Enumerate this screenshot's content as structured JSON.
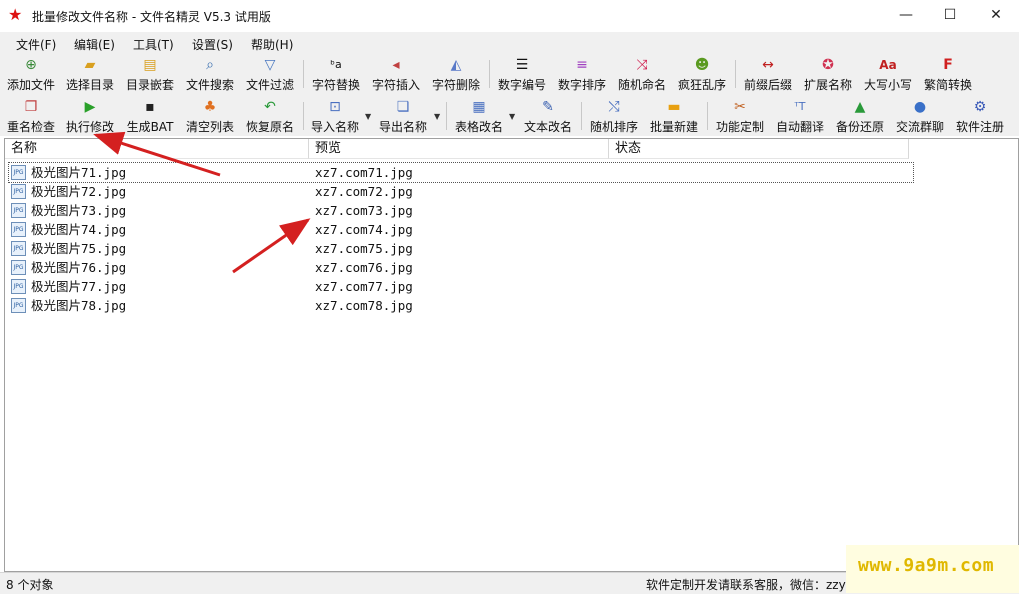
{
  "window": {
    "title": "批量修改文件名称 - 文件名精灵 V5.3 试用版",
    "controls": [
      "—",
      "☐",
      "✕"
    ]
  },
  "menu": [
    "文件(F)",
    "编辑(E)",
    "工具(T)",
    "设置(S)",
    "帮助(H)"
  ],
  "toolbar1": [
    {
      "label": "添加文件",
      "icon": "add-file-icon"
    },
    {
      "label": "选择目录",
      "icon": "folder-open-icon"
    },
    {
      "label": "目录嵌套",
      "icon": "folder-nest-icon"
    },
    {
      "label": "文件搜索",
      "icon": "search-icon"
    },
    {
      "label": "文件过滤",
      "icon": "filter-icon"
    },
    {
      "label": "字符替换",
      "icon": "replace-icon"
    },
    {
      "label": "字符插入",
      "icon": "insert-icon"
    },
    {
      "label": "字符删除",
      "icon": "eraser-icon"
    },
    {
      "label": "数字编号",
      "icon": "numbered-list-icon"
    },
    {
      "label": "数字排序",
      "icon": "sort-lines-icon"
    },
    {
      "label": "随机命名",
      "icon": "shuffle-icon"
    },
    {
      "label": "疯狂乱序",
      "icon": "crazy-face-icon"
    },
    {
      "label": "前缀后缀",
      "icon": "arrows-both-icon"
    },
    {
      "label": "扩展名称",
      "icon": "star-icon"
    },
    {
      "label": "大写小写",
      "icon": "case-icon"
    },
    {
      "label": "繁简转换",
      "icon": "f-letter-icon"
    }
  ],
  "toolbar2": [
    {
      "label": "重名检查",
      "icon": "duplicate-check-icon"
    },
    {
      "label": "执行修改",
      "icon": "play-icon"
    },
    {
      "label": "生成BAT",
      "icon": "console-icon"
    },
    {
      "label": "清空列表",
      "icon": "broom-icon"
    },
    {
      "label": "恢复原名",
      "icon": "undo-icon"
    },
    {
      "label": "导入名称",
      "icon": "import-icon"
    },
    {
      "label": "导出名称",
      "icon": "export-icon"
    },
    {
      "label": "表格改名",
      "icon": "table-icon"
    },
    {
      "label": "文本改名",
      "icon": "edit-text-icon"
    },
    {
      "label": "随机排序",
      "icon": "random-sort-icon"
    },
    {
      "label": "批量新建",
      "icon": "new-folder-icon"
    },
    {
      "label": "功能定制",
      "icon": "tools-icon"
    },
    {
      "label": "自动翻译",
      "icon": "translate-icon"
    },
    {
      "label": "备份还原",
      "icon": "drive-icon"
    },
    {
      "label": "交流群聊",
      "icon": "qq-icon"
    },
    {
      "label": "软件注册",
      "icon": "gear-icon"
    }
  ],
  "columns": [
    "名称",
    "预览",
    "状态"
  ],
  "files": [
    {
      "name": "极光图片71.jpg",
      "preview": "xz7.com71.jpg",
      "status": ""
    },
    {
      "name": "极光图片72.jpg",
      "preview": "xz7.com72.jpg",
      "status": ""
    },
    {
      "name": "极光图片73.jpg",
      "preview": "xz7.com73.jpg",
      "status": ""
    },
    {
      "name": "极光图片74.jpg",
      "preview": "xz7.com74.jpg",
      "status": ""
    },
    {
      "name": "极光图片75.jpg",
      "preview": "xz7.com75.jpg",
      "status": ""
    },
    {
      "name": "极光图片76.jpg",
      "preview": "xz7.com76.jpg",
      "status": ""
    },
    {
      "name": "极光图片77.jpg",
      "preview": "xz7.com77.jpg",
      "status": ""
    },
    {
      "name": "极光图片78.jpg",
      "preview": "xz7.com78.jpg",
      "status": ""
    }
  ],
  "file_icon_text": "JPG",
  "status": {
    "left": "8 个对象",
    "right": "软件定制开发请联系客服，微信：zzylov"
  },
  "watermark": "www.9a9m.com",
  "colors": {
    "accent_arrow": "#d42020",
    "title_icon": "#dd1111",
    "watermark": "#e0b800"
  }
}
